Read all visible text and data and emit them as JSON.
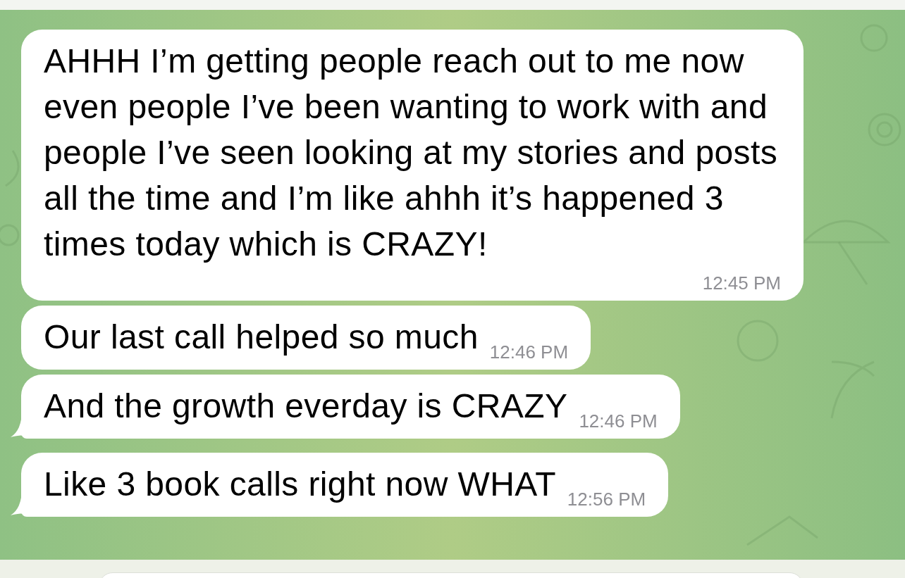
{
  "messages": [
    {
      "text": "AHHH I’m getting people reach out to me now even people I’ve been wanting to work with and people I’ve seen looking at my stories and posts all the time and I’m like ahhh it’s happened 3 times today which is CRAZY!",
      "time": "12:45 PM",
      "tail": false
    },
    {
      "text": "Our last call helped so much",
      "time": "12:46 PM",
      "tail": false
    },
    {
      "text": "And the growth everday is CRAZY",
      "time": "12:46 PM",
      "tail": true
    },
    {
      "text": "Like 3 book calls right now WHAT",
      "time": "12:56 PM",
      "tail": true
    }
  ]
}
